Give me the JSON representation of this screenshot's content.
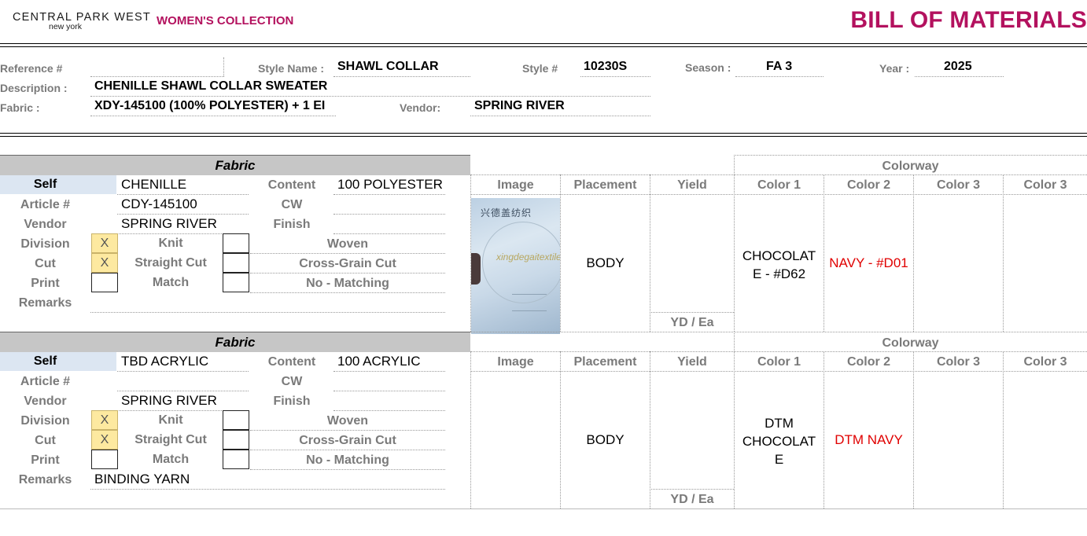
{
  "header": {
    "brand_line1": "CENTRAL PARK WEST",
    "brand_line2": "new york",
    "collection": "WOMEN'S COLLECTION",
    "doc_title": "BILL OF MATERIALS"
  },
  "info": {
    "reference_label": "Reference #",
    "reference_value": "",
    "style_name_label": "Style Name :",
    "style_name_value": "SHAWL COLLAR",
    "style_no_label": "Style #",
    "style_no_value": "10230S",
    "season_label": "Season :",
    "season_value": "FA 3",
    "year_label": "Year :",
    "year_value": "2025",
    "description_label": "Description :",
    "description_value": "CHENILLE SHAWL COLLAR SWEATER",
    "fabric_label": "Fabric :",
    "fabric_value": "XDY-145100 (100% POLYESTER) + 1 EI",
    "vendor_label": "Vendor:",
    "vendor_value": "SPRING RIVER"
  },
  "labels": {
    "fabric_header": "Fabric",
    "self": "Self",
    "article": "Article #",
    "vendor": "Vendor",
    "division": "Division",
    "cut": "Cut",
    "print": "Print",
    "remarks": "Remarks",
    "content": "Content",
    "cw": "CW",
    "finish": "Finish",
    "knit": "Knit",
    "woven": "Woven",
    "straight_cut": "Straight Cut",
    "cross_grain_cut": "Cross-Grain Cut",
    "match": "Match",
    "no_matching": "No - Matching",
    "colorway": "Colorway",
    "image": "Image",
    "placement": "Placement",
    "yield": "Yield",
    "color1": "Color 1",
    "color2": "Color 2",
    "color3": "Color 3",
    "color3b": "Color 3",
    "yield_unit": "YD / Ea"
  },
  "fabrics": [
    {
      "self": "CHENILLE",
      "article": "CDY-145100",
      "vendor": "SPRING RIVER",
      "content": "100 POLYESTER",
      "cw": "",
      "finish": "",
      "division_knit": "X",
      "cut_straight": "X",
      "remarks": "",
      "image_text_cn": "兴德盖纺织",
      "image_text_script": "xingdegaitextile",
      "placement": "BODY",
      "yield": "",
      "color1": "CHOCOLAT E - #D62",
      "color2": "NAVY - #D01",
      "color3": "",
      "color4": ""
    },
    {
      "self": "TBD ACRYLIC",
      "article": "",
      "vendor": "SPRING RIVER",
      "content": "100 ACRYLIC",
      "cw": "",
      "finish": "",
      "division_knit": "X",
      "cut_straight": "X",
      "remarks": "BINDING YARN",
      "placement": "BODY",
      "yield": "",
      "color1": "DTM CHOCOLAT E",
      "color2": "DTM NAVY",
      "color3": "",
      "color4": ""
    }
  ],
  "colors": {
    "brand": "#b3115e",
    "highlight_red": "#e00000",
    "self_bg": "#dce6f2",
    "mark_bg": "#fde9a0",
    "header_gray": "#c6c6c6"
  }
}
